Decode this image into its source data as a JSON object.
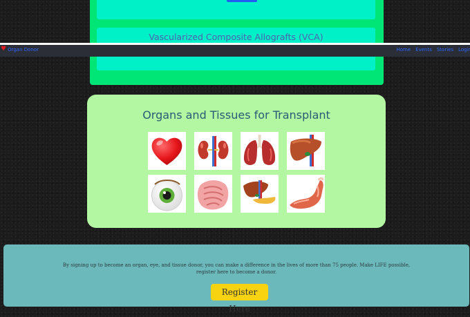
{
  "vca": {
    "title": "Vascularized Composite Allografts (VCA)"
  },
  "navbar": {
    "brand_icon": "heart-icon",
    "brand_text": "Organ Donor",
    "links": [
      "Home",
      "Events",
      "Stories",
      "Login"
    ]
  },
  "organs": {
    "title": "Organs and Tissues for Transplant",
    "icons": [
      "heart-icon",
      "kidney-icon",
      "lungs-icon",
      "liver-icon",
      "eye-icon",
      "intestine-icon",
      "pancreas-icon",
      "arm-tissue-icon"
    ]
  },
  "register": {
    "text": "By signing up to become an organ, eye, and tissue donor, you can make a difference in the lives of more than 75 people. Make LIFE possible, register here to become a donor.",
    "button_label": "Register Here"
  },
  "colors": {
    "page_bg": "#1c1c1c",
    "vca_outer": "#00e676",
    "vca_inner": "#00f0c8",
    "organs_card": "#b3f7a3",
    "register_bg": "#6bb9bb",
    "button_bg": "#f7d311",
    "link": "#2a66ff"
  }
}
